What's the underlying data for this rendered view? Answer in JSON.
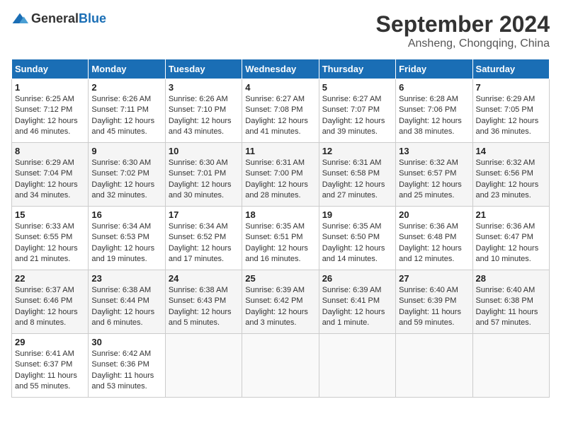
{
  "logo": {
    "general": "General",
    "blue": "Blue"
  },
  "title": "September 2024",
  "location": "Ansheng, Chongqing, China",
  "headers": [
    "Sunday",
    "Monday",
    "Tuesday",
    "Wednesday",
    "Thursday",
    "Friday",
    "Saturday"
  ],
  "weeks": [
    [
      {
        "day": "1",
        "sunrise": "6:25 AM",
        "sunset": "7:12 PM",
        "daylight": "12 hours and 46 minutes."
      },
      {
        "day": "2",
        "sunrise": "6:26 AM",
        "sunset": "7:11 PM",
        "daylight": "12 hours and 45 minutes."
      },
      {
        "day": "3",
        "sunrise": "6:26 AM",
        "sunset": "7:10 PM",
        "daylight": "12 hours and 43 minutes."
      },
      {
        "day": "4",
        "sunrise": "6:27 AM",
        "sunset": "7:08 PM",
        "daylight": "12 hours and 41 minutes."
      },
      {
        "day": "5",
        "sunrise": "6:27 AM",
        "sunset": "7:07 PM",
        "daylight": "12 hours and 39 minutes."
      },
      {
        "day": "6",
        "sunrise": "6:28 AM",
        "sunset": "7:06 PM",
        "daylight": "12 hours and 38 minutes."
      },
      {
        "day": "7",
        "sunrise": "6:29 AM",
        "sunset": "7:05 PM",
        "daylight": "12 hours and 36 minutes."
      }
    ],
    [
      {
        "day": "8",
        "sunrise": "6:29 AM",
        "sunset": "7:04 PM",
        "daylight": "12 hours and 34 minutes."
      },
      {
        "day": "9",
        "sunrise": "6:30 AM",
        "sunset": "7:02 PM",
        "daylight": "12 hours and 32 minutes."
      },
      {
        "day": "10",
        "sunrise": "6:30 AM",
        "sunset": "7:01 PM",
        "daylight": "12 hours and 30 minutes."
      },
      {
        "day": "11",
        "sunrise": "6:31 AM",
        "sunset": "7:00 PM",
        "daylight": "12 hours and 28 minutes."
      },
      {
        "day": "12",
        "sunrise": "6:31 AM",
        "sunset": "6:58 PM",
        "daylight": "12 hours and 27 minutes."
      },
      {
        "day": "13",
        "sunrise": "6:32 AM",
        "sunset": "6:57 PM",
        "daylight": "12 hours and 25 minutes."
      },
      {
        "day": "14",
        "sunrise": "6:32 AM",
        "sunset": "6:56 PM",
        "daylight": "12 hours and 23 minutes."
      }
    ],
    [
      {
        "day": "15",
        "sunrise": "6:33 AM",
        "sunset": "6:55 PM",
        "daylight": "12 hours and 21 minutes."
      },
      {
        "day": "16",
        "sunrise": "6:34 AM",
        "sunset": "6:53 PM",
        "daylight": "12 hours and 19 minutes."
      },
      {
        "day": "17",
        "sunrise": "6:34 AM",
        "sunset": "6:52 PM",
        "daylight": "12 hours and 17 minutes."
      },
      {
        "day": "18",
        "sunrise": "6:35 AM",
        "sunset": "6:51 PM",
        "daylight": "12 hours and 16 minutes."
      },
      {
        "day": "19",
        "sunrise": "6:35 AM",
        "sunset": "6:50 PM",
        "daylight": "12 hours and 14 minutes."
      },
      {
        "day": "20",
        "sunrise": "6:36 AM",
        "sunset": "6:48 PM",
        "daylight": "12 hours and 12 minutes."
      },
      {
        "day": "21",
        "sunrise": "6:36 AM",
        "sunset": "6:47 PM",
        "daylight": "12 hours and 10 minutes."
      }
    ],
    [
      {
        "day": "22",
        "sunrise": "6:37 AM",
        "sunset": "6:46 PM",
        "daylight": "12 hours and 8 minutes."
      },
      {
        "day": "23",
        "sunrise": "6:38 AM",
        "sunset": "6:44 PM",
        "daylight": "12 hours and 6 minutes."
      },
      {
        "day": "24",
        "sunrise": "6:38 AM",
        "sunset": "6:43 PM",
        "daylight": "12 hours and 5 minutes."
      },
      {
        "day": "25",
        "sunrise": "6:39 AM",
        "sunset": "6:42 PM",
        "daylight": "12 hours and 3 minutes."
      },
      {
        "day": "26",
        "sunrise": "6:39 AM",
        "sunset": "6:41 PM",
        "daylight": "12 hours and 1 minute."
      },
      {
        "day": "27",
        "sunrise": "6:40 AM",
        "sunset": "6:39 PM",
        "daylight": "11 hours and 59 minutes."
      },
      {
        "day": "28",
        "sunrise": "6:40 AM",
        "sunset": "6:38 PM",
        "daylight": "11 hours and 57 minutes."
      }
    ],
    [
      {
        "day": "29",
        "sunrise": "6:41 AM",
        "sunset": "6:37 PM",
        "daylight": "11 hours and 55 minutes."
      },
      {
        "day": "30",
        "sunrise": "6:42 AM",
        "sunset": "6:36 PM",
        "daylight": "11 hours and 53 minutes."
      },
      null,
      null,
      null,
      null,
      null
    ]
  ]
}
